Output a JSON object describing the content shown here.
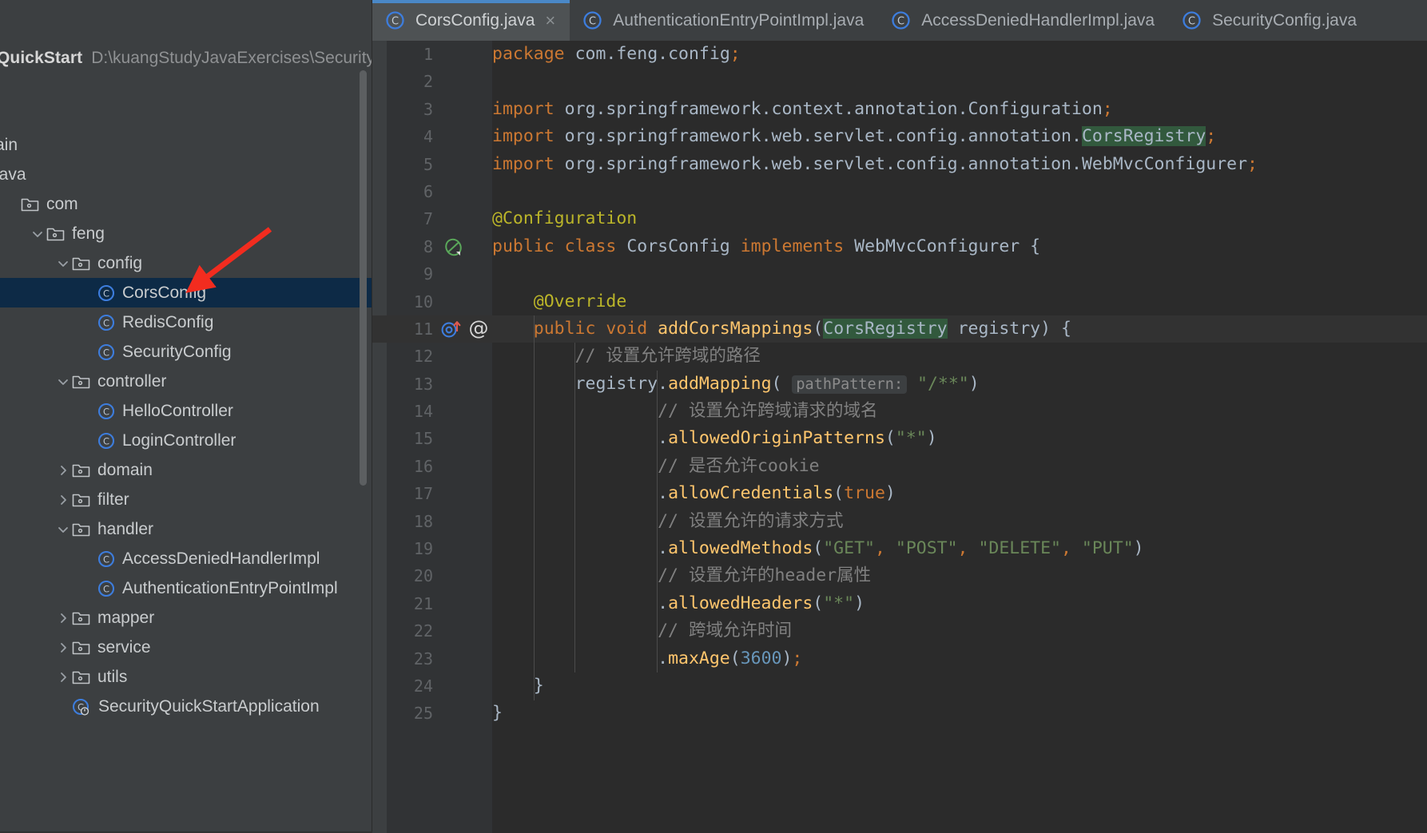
{
  "project": {
    "name": "QuickStart",
    "path": "D:\\kuangStudyJavaExercises\\SecurityQ"
  },
  "sidebar": {
    "items": [
      {
        "label": "ain",
        "type": "folder-partial",
        "indent": 0,
        "twist": "",
        "icon": "none",
        "selected": false
      },
      {
        "label": "java",
        "type": "source-root",
        "indent": 0,
        "twist": "",
        "icon": "none",
        "selected": false
      },
      {
        "label": "com",
        "type": "package",
        "indent": 1,
        "twist": "",
        "icon": "folder",
        "selected": false
      },
      {
        "label": "feng",
        "type": "package",
        "indent": 2,
        "twist": "down",
        "icon": "folder",
        "selected": false
      },
      {
        "label": "config",
        "type": "package",
        "indent": 3,
        "twist": "down",
        "icon": "folder",
        "selected": false
      },
      {
        "label": "CorsConfig",
        "type": "class",
        "indent": 4,
        "twist": "",
        "icon": "class",
        "selected": true
      },
      {
        "label": "RedisConfig",
        "type": "class",
        "indent": 4,
        "twist": "",
        "icon": "class",
        "selected": false
      },
      {
        "label": "SecurityConfig",
        "type": "class",
        "indent": 4,
        "twist": "",
        "icon": "class",
        "selected": false
      },
      {
        "label": "controller",
        "type": "package",
        "indent": 3,
        "twist": "down",
        "icon": "folder",
        "selected": false
      },
      {
        "label": "HelloController",
        "type": "class",
        "indent": 4,
        "twist": "",
        "icon": "class",
        "selected": false
      },
      {
        "label": "LoginController",
        "type": "class",
        "indent": 4,
        "twist": "",
        "icon": "class",
        "selected": false
      },
      {
        "label": "domain",
        "type": "package",
        "indent": 3,
        "twist": "right",
        "icon": "folder",
        "selected": false
      },
      {
        "label": "filter",
        "type": "package",
        "indent": 3,
        "twist": "right",
        "icon": "folder",
        "selected": false
      },
      {
        "label": "handler",
        "type": "package",
        "indent": 3,
        "twist": "down",
        "icon": "folder",
        "selected": false
      },
      {
        "label": "AccessDeniedHandlerImpl",
        "type": "class",
        "indent": 4,
        "twist": "",
        "icon": "class",
        "selected": false
      },
      {
        "label": "AuthenticationEntryPointImpl",
        "type": "class",
        "indent": 4,
        "twist": "",
        "icon": "class",
        "selected": false
      },
      {
        "label": "mapper",
        "type": "package",
        "indent": 3,
        "twist": "right",
        "icon": "folder",
        "selected": false
      },
      {
        "label": "service",
        "type": "package",
        "indent": 3,
        "twist": "right",
        "icon": "folder",
        "selected": false
      },
      {
        "label": "utils",
        "type": "package",
        "indent": 3,
        "twist": "right",
        "icon": "folder",
        "selected": false
      },
      {
        "label": "SecurityQuickStartApplication",
        "type": "class-runnable",
        "indent": 3,
        "twist": "",
        "icon": "class",
        "selected": false
      }
    ]
  },
  "tabs": [
    {
      "label": "CorsConfig.java",
      "icon": "java-class-icon",
      "active": true,
      "closable": true
    },
    {
      "label": "AuthenticationEntryPointImpl.java",
      "icon": "java-class-icon",
      "active": false,
      "closable": false
    },
    {
      "label": "AccessDeniedHandlerImpl.java",
      "icon": "java-class-icon",
      "active": false,
      "closable": false
    },
    {
      "label": "SecurityConfig.java",
      "icon": "java-class-icon",
      "active": false,
      "closable": false
    }
  ],
  "editor": {
    "filename": "CorsConfig.java",
    "current_line": 11,
    "gutter_icons": [
      {
        "line": 8,
        "icon": "spring-bean-icon"
      },
      {
        "line": 11,
        "icon": "implementing-method-icon"
      },
      {
        "line": 11,
        "icon": "annotation-at-icon"
      }
    ],
    "search_highlight": "CorsRegistry",
    "parameter_hint": "pathPattern:",
    "lines": [
      {
        "n": 1,
        "text": "package com.feng.config;"
      },
      {
        "n": 2,
        "text": ""
      },
      {
        "n": 3,
        "text": "import org.springframework.context.annotation.Configuration;"
      },
      {
        "n": 4,
        "text": "import org.springframework.web.servlet.config.annotation.CorsRegistry;"
      },
      {
        "n": 5,
        "text": "import org.springframework.web.servlet.config.annotation.WebMvcConfigurer;"
      },
      {
        "n": 6,
        "text": ""
      },
      {
        "n": 7,
        "text": "@Configuration"
      },
      {
        "n": 8,
        "text": "public class CorsConfig implements WebMvcConfigurer {"
      },
      {
        "n": 9,
        "text": ""
      },
      {
        "n": 10,
        "text": "    @Override"
      },
      {
        "n": 11,
        "text": "    public void addCorsMappings(CorsRegistry registry) {"
      },
      {
        "n": 12,
        "text": "        // 设置允许跨域的路径"
      },
      {
        "n": 13,
        "text": "        registry.addMapping( pathPattern: \"/**\")"
      },
      {
        "n": 14,
        "text": "                // 设置允许跨域请求的域名"
      },
      {
        "n": 15,
        "text": "                .allowedOriginPatterns(\"*\")"
      },
      {
        "n": 16,
        "text": "                // 是否允许cookie"
      },
      {
        "n": 17,
        "text": "                .allowCredentials(true)"
      },
      {
        "n": 18,
        "text": "                // 设置允许的请求方式"
      },
      {
        "n": 19,
        "text": "                .allowedMethods(\"GET\", \"POST\", \"DELETE\", \"PUT\")"
      },
      {
        "n": 20,
        "text": "                // 设置允许的header属性"
      },
      {
        "n": 21,
        "text": "                .allowedHeaders(\"*\")"
      },
      {
        "n": 22,
        "text": "                // 跨域允许时间"
      },
      {
        "n": 23,
        "text": "                .maxAge(3600);"
      },
      {
        "n": 24,
        "text": "    }"
      },
      {
        "n": 25,
        "text": "}"
      }
    ]
  },
  "annotation": {
    "type": "red-arrow",
    "points_to": "CorsConfig",
    "color": "#f22c1f"
  },
  "colors": {
    "accent": "#4a88c7",
    "selection": "#0d2a46",
    "editor_bg": "#2b2b2b",
    "panel_bg": "#3c3f41",
    "gutter_bg": "#313335",
    "keyword": "#cc7832",
    "string": "#6a8759",
    "comment": "#808080",
    "annotation": "#bbb529",
    "number": "#6897bb",
    "method": "#ffc66d",
    "highlight": "#32593d"
  }
}
